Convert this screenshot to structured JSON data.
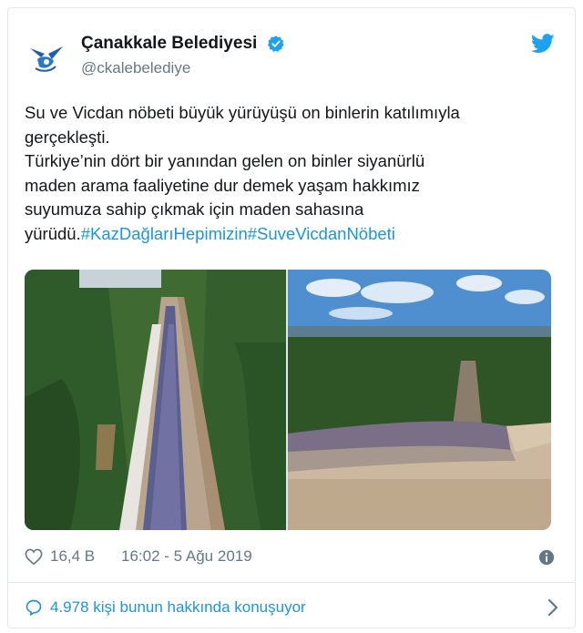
{
  "account": {
    "display_name": "Çanakkale Belediyesi",
    "handle": "@ckalebelediye"
  },
  "tweet": {
    "lines": [
      "Su ve Vicdan nöbeti büyük yürüyüşü on binlerin katılımıyla",
      "gerçekleşti.",
      "Türkiye’nin dört bir yanından gelen on binler siyanürlü",
      "maden arama faaliyetine dur demek yaşam hakkımız",
      "suyumuza sahip çıkmak için  maden sahasına"
    ],
    "last_line_prefix": "yürüdü.",
    "hashtags": [
      "#KazDağlarıHepimizin",
      "#SuveVicdanNöbeti"
    ]
  },
  "meta": {
    "likes": "16,4 B",
    "timestamp": "16:02 - 5 Ağu 2019"
  },
  "footer": {
    "conversation": "4.978 kişi bunun hakkında konuşuyor"
  },
  "colors": {
    "link": "#1b95e0",
    "verified": "#1da1f2",
    "secondary_text": "#657786",
    "border": "#e1e8ed"
  },
  "icons": [
    "municipality-logo-icon",
    "verified-badge-icon",
    "twitter-bird-icon",
    "heart-icon",
    "info-icon",
    "speech-bubble-icon",
    "chevron-right-icon"
  ]
}
